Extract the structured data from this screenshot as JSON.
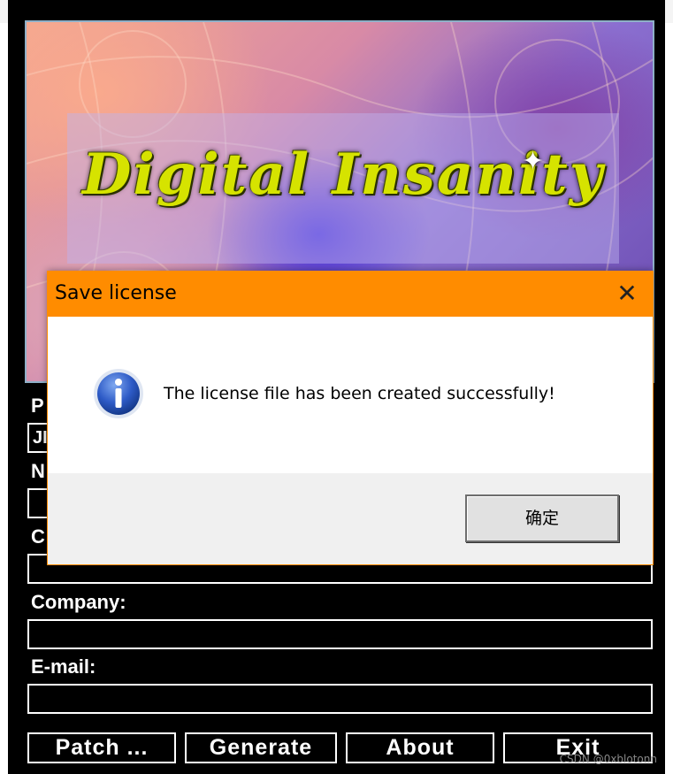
{
  "banner": {
    "logo_text": "Digital Insanity"
  },
  "fields": [
    {
      "label": "P",
      "value": "JI"
    },
    {
      "label": "N",
      "value": ""
    },
    {
      "label": "C",
      "value": ""
    },
    {
      "label": "Company:",
      "value": ""
    },
    {
      "label": "E-mail:",
      "value": ""
    }
  ],
  "buttons": {
    "patch": "Patch ...",
    "generate": "Generate",
    "about": "About",
    "exit": "Exit"
  },
  "dialog": {
    "title": "Save license",
    "message": "The license file has been created successfully!",
    "ok_label": "确定",
    "close_glyph": "✕",
    "icon": "info-icon"
  },
  "watermark": "CSDN @0xblotonn"
}
